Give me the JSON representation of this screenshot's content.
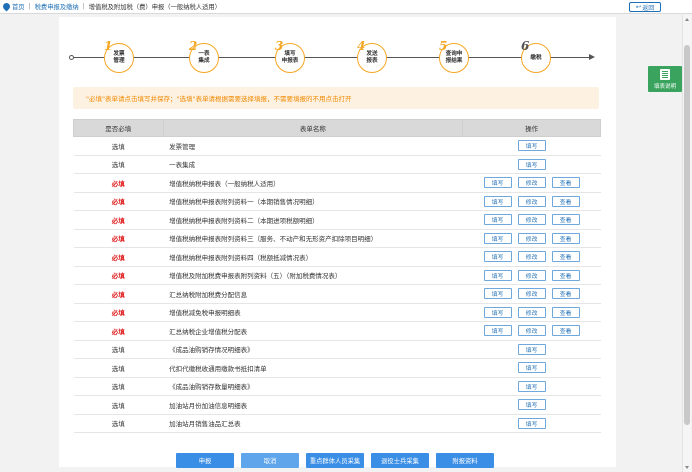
{
  "breadcrumb": {
    "home": "首页",
    "section": "税费申报及缴纳",
    "current": "增值税及附加税（费）申报（一般纳税人适用）"
  },
  "back_label": "返回",
  "steps": [
    {
      "num": "1",
      "label1": "发票",
      "label2": "管理"
    },
    {
      "num": "2",
      "label1": "一表",
      "label2": "集成"
    },
    {
      "num": "3",
      "label1": "填写",
      "label2": "申报表"
    },
    {
      "num": "4",
      "label1": "发送",
      "label2": "报表"
    },
    {
      "num": "5",
      "label1": "查询申",
      "label2": "报结果"
    },
    {
      "num": "6",
      "label1": "缴税",
      "label2": ""
    }
  ],
  "notice": "\"必填\"表单请点击填写并保存；\"选填\"表单请根据需要选择填报，不需要填报的不用点击打开",
  "fill_tip": "填表说明",
  "table": {
    "headers": [
      "是否必填",
      "表单名称",
      "操作"
    ],
    "btn_fill": "填写",
    "btn_modify": "修改",
    "btn_view": "查看",
    "rows": [
      {
        "req": "选填",
        "name": "发票管理",
        "ops": "fill"
      },
      {
        "req": "选填",
        "name": "一表集成",
        "ops": "fill"
      },
      {
        "req": "必填",
        "name": "增值税纳税申报表（一般纳税人适用）",
        "ops": "full"
      },
      {
        "req": "必填",
        "name": "增值税纳税申报表附列资料一（本期销售情况明细）",
        "ops": "full"
      },
      {
        "req": "必填",
        "name": "增值税纳税申报表附列资料二（本期进项税额明细）",
        "ops": "full"
      },
      {
        "req": "必填",
        "name": "增值税纳税申报表附列资料三（服务、不动产和无形资产扣除项目明细）",
        "ops": "full"
      },
      {
        "req": "必填",
        "name": "增值税纳税申报表附列资料四（税额抵减情况表）",
        "ops": "full"
      },
      {
        "req": "必填",
        "name": "增值税及附加税费申报表附列资料（五）（附加税费情况表）",
        "ops": "full"
      },
      {
        "req": "必填",
        "name": "汇总纳税附加税费分配信息",
        "ops": "full"
      },
      {
        "req": "必填",
        "name": "增值税减免税申报明细表",
        "ops": "full"
      },
      {
        "req": "必填",
        "name": "汇总纳税企业增值税分配表",
        "ops": "full"
      },
      {
        "req": "选填",
        "name": "《成品油购销存情况明细表》",
        "ops": "fill"
      },
      {
        "req": "选填",
        "name": "代扣代缴税收通用缴款书抵扣清单",
        "ops": "fill"
      },
      {
        "req": "选填",
        "name": "《成品油购销存数量明细表》",
        "ops": "fill"
      },
      {
        "req": "选填",
        "name": "加油站月份加油信息明细表",
        "ops": "fill"
      },
      {
        "req": "选填",
        "name": "加油站月销售油品汇总表",
        "ops": "fill"
      }
    ]
  },
  "bottom_buttons": [
    "申报",
    "取消",
    "重点群体人员采集",
    "退役士兵采集",
    "附报资料"
  ],
  "colors": {
    "accent": "#1f6fb5",
    "step": "#f5a623",
    "required": "#e02020",
    "notice": "#f08a00",
    "primary": "#3a8ee6"
  }
}
